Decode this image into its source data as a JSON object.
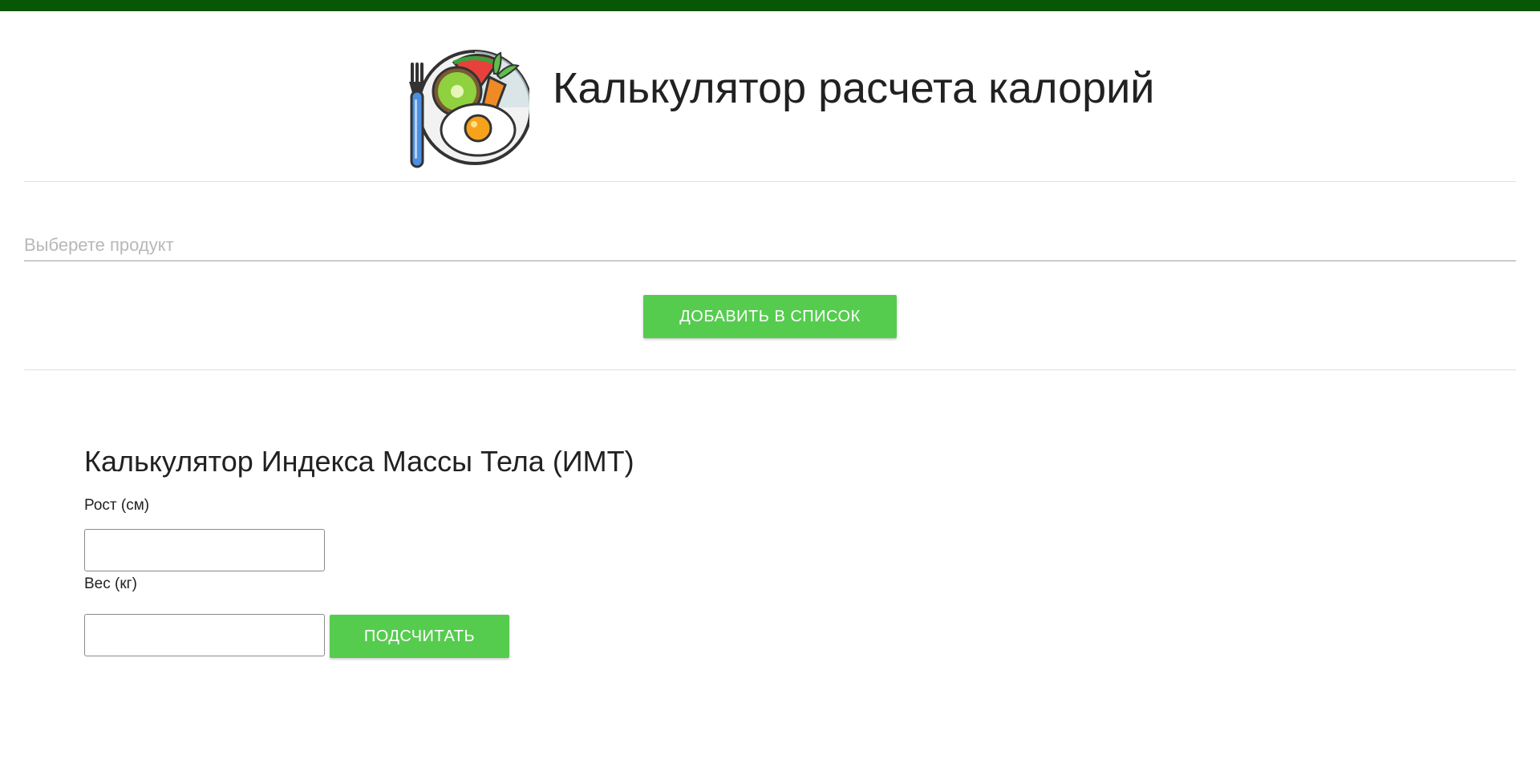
{
  "header": {
    "title": "Калькулятор расчета калорий",
    "logo_icon": "plate-food-icon"
  },
  "product": {
    "placeholder": "Выберете продукт",
    "value": "",
    "add_button_label": "ДОБАВИТЬ В СПИСОК"
  },
  "bmi": {
    "title": "Калькулятор Индекса Массы Тела (ИМТ)",
    "height_label": "Рост (см)",
    "height_value": "",
    "weight_label": "Вес (кг)",
    "weight_value": "",
    "calc_button_label": "ПОДСЧИТАТЬ"
  },
  "colors": {
    "topbar": "#075707",
    "button": "#56cc4f",
    "text": "#212121",
    "placeholder": "#b8b8b8"
  }
}
